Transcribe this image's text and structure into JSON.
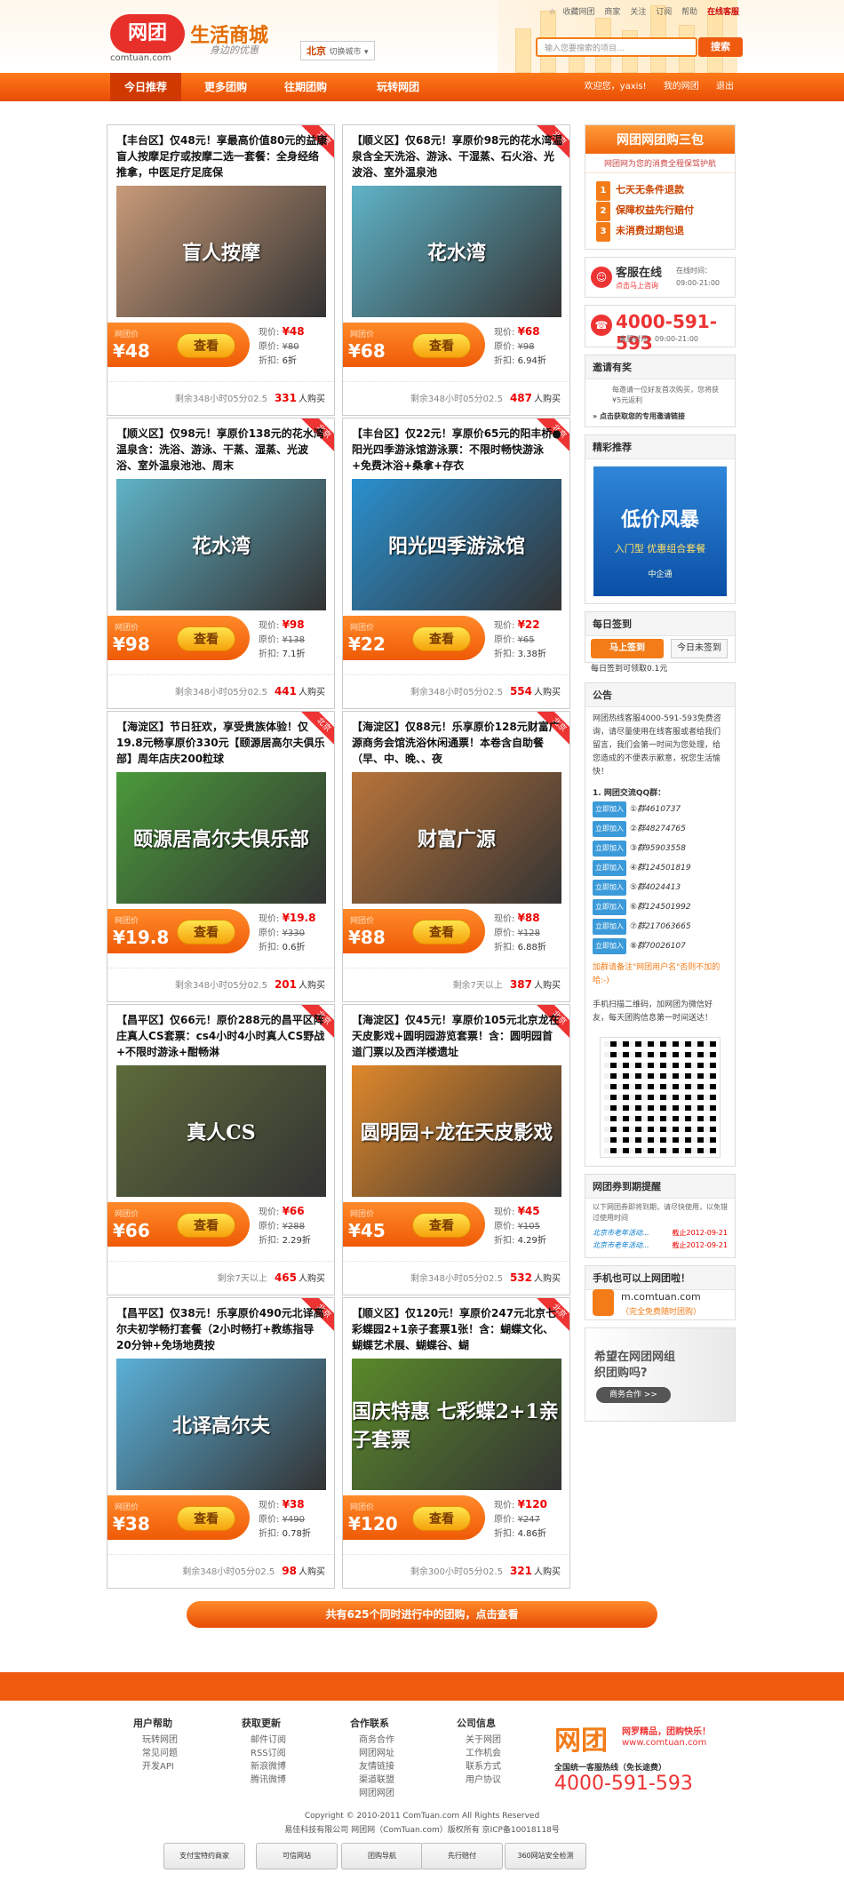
{
  "header": {
    "logo_text": "网团",
    "logo_url": "comtuan.com",
    "slogan": "生活商城",
    "slogan_sub": "身边的优惠",
    "city": "北京",
    "city_switch": "切换城市",
    "top_links": [
      "收藏网团",
      "商家",
      "关注",
      "订阅",
      "帮助",
      "在线客服"
    ],
    "search_placeholder": "输入您要搜索的项目...",
    "search_button": "搜索"
  },
  "nav": {
    "items": [
      "今日推荐",
      "更多团购",
      "往期团购",
      "玩转网团"
    ],
    "welcome": "欢迎您，yaxis!",
    "my": "我的网团",
    "logout": "退出"
  },
  "labels": {
    "ribbon": "北京",
    "price_label": "网团价",
    "button": "查看",
    "now": "现价:",
    "old": "原价:",
    "discount": "折扣:",
    "bought": "人购买"
  },
  "deals": [
    {
      "title": "【丰台区】仅48元！享最高价值80元的益康盲人按摩足疗或按摩二选一套餐：全身经络推拿，中医足疗足底保",
      "img": "盲人按摩",
      "price": "¥48",
      "now": "¥48",
      "old": "¥80",
      "disc": "6折",
      "time": "剩余348小时05分02.5",
      "count": "331",
      "color": "#c89a78"
    },
    {
      "title": "【顺义区】仅68元！享原价98元的花水湾温泉含全天洗浴、游泳、干湿蒸、石火浴、光波浴、室外温泉池",
      "img": "花水湾",
      "price": "¥68",
      "now": "¥68",
      "old": "¥98",
      "disc": "6.94折",
      "time": "剩余348小时05分02.5",
      "count": "487",
      "color": "#5fb3c7"
    },
    {
      "title": "【顺义区】仅98元！享原价138元的花水湾温泉含：洗浴、游泳、干蒸、湿蒸、光波浴、室外温泉池池、周末",
      "img": "花水湾",
      "price": "¥98",
      "now": "¥98",
      "old": "¥138",
      "disc": "7.1折",
      "time": "剩余348小时05分02.5",
      "count": "441",
      "color": "#5fb3c7"
    },
    {
      "title": "【丰台区】仅22元！享原价65元的阳丰桥●阳光四季游泳馆游泳票：不限时畅快游泳+免费沐浴+桑拿+存衣",
      "img": "阳光四季游泳馆",
      "price": "¥22",
      "now": "¥22",
      "old": "¥65",
      "disc": "3.38折",
      "time": "剩余348小时05分02.5",
      "count": "554",
      "color": "#2a90cf"
    },
    {
      "title": "【海淀区】节日狂欢，享受贵族体验！仅19.8元畅享原价330元【颐源居高尔夫俱乐部】周年店庆200粒球",
      "img": "颐源居高尔夫俱乐部",
      "price": "¥19.8",
      "now": "¥19.8",
      "old": "¥330",
      "disc": "0.6折",
      "time": "剩余348小时05分02.5",
      "count": "201",
      "color": "#4a9a3a"
    },
    {
      "title": "【海淀区】仅88元！乐享原价128元财富广源商务会馆洗浴休闲通票！本卷含自助餐（早、中、晚、、夜",
      "img": "财富广源",
      "price": "¥88",
      "now": "¥88",
      "old": "¥128",
      "disc": "6.88折",
      "time": "剩余7天以上",
      "count": "387",
      "color": "#b8743a"
    },
    {
      "title": "【昌平区】仅66元！原价288元的昌平区阵庄真人CS套票：cs4小时4小时真人CS野战+不限时游泳+酣畅淋",
      "img": "真人CS",
      "price": "¥66",
      "now": "¥66",
      "old": "¥288",
      "disc": "2.29折",
      "time": "剩余7天以上",
      "count": "465",
      "color": "#5d6b3a"
    },
    {
      "title": "【海淀区】仅45元！享原价105元北京龙在天皮影戏+圆明园游览套票！含：圆明园首道门票以及西洋楼遗址",
      "img": "圆明园+龙在天皮影戏",
      "price": "¥45",
      "now": "¥45",
      "old": "¥105",
      "disc": "4.29折",
      "time": "剩余348小时05分02.5",
      "count": "532",
      "color": "#e0882a"
    },
    {
      "title": "【昌平区】仅38元！乐享原价490元北译高尔夫初学畅打套餐（2小时畅打+教练指导20分钟+免场地费按",
      "img": "北译高尔夫",
      "price": "¥38",
      "now": "¥38",
      "old": "¥490",
      "disc": "0.78折",
      "time": "剩余348小时05分02.5",
      "count": "98",
      "color": "#5ab0d8"
    },
    {
      "title": "【顺义区】仅120元！享原价247元北京七彩蝶园2+1亲子套票1张！含：蝴蝶文化、蝴蝶艺术展、蝴蝶谷、蝴",
      "img": "国庆特惠 七彩蝶2+1亲子套票",
      "price": "¥120",
      "now": "¥120",
      "old": "¥247",
      "disc": "4.86折",
      "time": "剩余300小时05分02.5",
      "count": "321",
      "color": "#5a8a2a"
    }
  ],
  "sidebar": {
    "pkg_title": "网团网团购三包",
    "pkg_sub": "网团网为您的消费全程保驾护航",
    "pkg_items": [
      "七天无条件退款",
      "保障权益先行赔付",
      "未消费过期包退"
    ],
    "kefu_title": "客服在线",
    "kefu_sub": "点击马上咨询",
    "kefu_time_label": "在线时间：",
    "kefu_time": "09:00-21:00",
    "hotline": "4000-591-593",
    "hotline_time": "客服时间：09:00-21:00",
    "invite_title": "邀请有奖",
    "invite_text": "每邀请一位好友首次购买，您将获¥5元返利",
    "invite_link": "» 点击获取您的专用邀请链接",
    "promo_title": "精彩推荐",
    "promo_big": "低价风暴",
    "promo_sub": "入门型 优惠组合套餐",
    "promo_logo": "中企通",
    "sign_title": "每日签到",
    "sign_btn": "马上签到",
    "sign_today": "今日未签到",
    "sign_text": "每日签到可领取0.1元",
    "notice_title": "公告",
    "notice_text": "网团热线客服4000-591-593免费咨询，请尽量使用在线客服或者给我们留言，我们会第一时间为您处理，给您造成的不便表示歉意，祝您生活愉快！",
    "qq_title": "1. 网团交流QQ群：",
    "qq_join": "立即加入",
    "qq_groups": [
      "①群4610737",
      "②群48274765",
      "③群95903558",
      "④群124501819",
      "⑤群4024413",
      "⑥群124501992",
      "⑦群217063665",
      "⑧群70026107"
    ],
    "notice_tip": "加群请备注\"网团用户名\"否则不加的哈:-)",
    "notice_scan": "手机扫描二维码，加网团为微信好友，每天团购信息第一时间送达！",
    "remind_title": "网团券到期提醒",
    "remind_text": "以下网团券即将到期，请尽快使用，以免错过使用时间",
    "remind_rows": [
      {
        "name": "北京市老年活动...",
        "date": "截止2012-09-21"
      },
      {
        "name": "北京市老年活动...",
        "date": "截止2012-09-21"
      }
    ],
    "mobile_title": "手机也可以上网团啦！",
    "mobile_url": "m.comtuan.com",
    "mobile_sub": "（完全免费随时团购）",
    "coop_text": "希望在网团网组织团购吗?",
    "coop_btn": "商务合作 >>"
  },
  "more_button": "共有625个同时进行中的团购，点击查看",
  "footer": {
    "cols": [
      {
        "title": "用户帮助",
        "items": [
          "玩转网团",
          "常见问题",
          "开发API"
        ]
      },
      {
        "title": "获取更新",
        "items": [
          "邮件订阅",
          "RSS订阅",
          "新浪微博",
          "腾讯微博"
        ]
      },
      {
        "title": "合作联系",
        "items": [
          "商务合作",
          "网团网址",
          "友情链接",
          "渠道联盟",
          "网团网团"
        ]
      },
      {
        "title": "公司信息",
        "items": [
          "关于网团",
          "工作机会",
          "联系方式",
          "用户协议"
        ]
      }
    ],
    "brand": "网团",
    "brand_slogan": "网罗精品，团购快乐！",
    "brand_url": "www.comtuan.com",
    "hotline_label": "全国统一客服热线（免长途费）",
    "hotline": "4000-591-593",
    "copyright": "Copyright © 2010-2011 ComTuan.com All Rights Reserved",
    "icp": "易佳科技有限公司 网团网（ComTuan.com）版权所有 京ICP备10018118号",
    "badges": [
      "支付宝特约商家",
      "可信网站",
      "团购导航",
      "先行赔付",
      "360网站安全检测"
    ]
  }
}
